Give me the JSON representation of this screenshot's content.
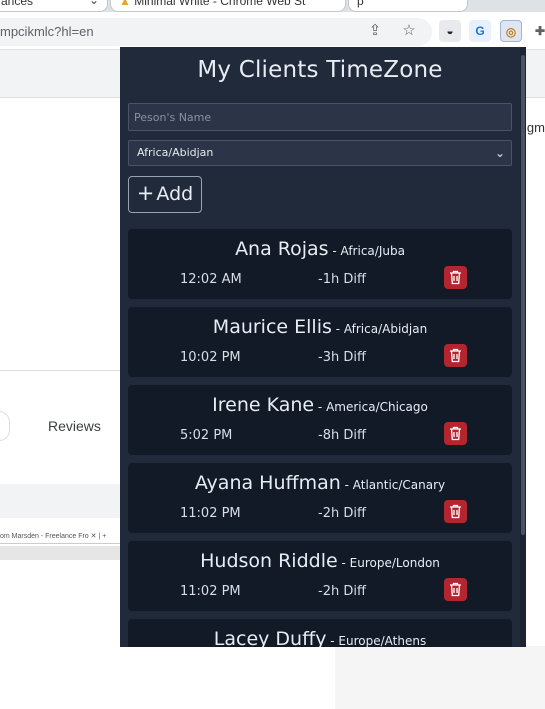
{
  "browser": {
    "tabs": [
      {
        "title": "ances"
      },
      {
        "title": "Minimal White - Chrome Web St"
      },
      {
        "title": "p"
      }
    ],
    "url": "mpcikmlc?hl=en",
    "icons": {
      "share": "share-icon",
      "bookmark": "star-icon",
      "ext1": "incognito-icon",
      "ext2": "translate-icon",
      "ext3": "timezone-extension-icon",
      "puzzle": "extensions-puzzle-icon"
    }
  },
  "page": {
    "right_text": "igma",
    "reviews_tab": "Reviews",
    "mini_tab_text": "om Marsden - Freelance Fro"
  },
  "popup": {
    "title": "My Clients TimeZone",
    "name_input": {
      "placeholder": "Peson's Name",
      "value": ""
    },
    "timezone_select": {
      "value": "Africa/Abidjan"
    },
    "add_button": {
      "label": "Add"
    },
    "clients": [
      {
        "name": "Ana Rojas",
        "timezone": "Africa/Juba",
        "time": "12:02 AM",
        "diff": "-1h Diff"
      },
      {
        "name": "Maurice Ellis",
        "timezone": "Africa/Abidjan",
        "time": "10:02 PM",
        "diff": "-3h Diff"
      },
      {
        "name": "Irene Kane",
        "timezone": "America/Chicago",
        "time": "5:02 PM",
        "diff": "-8h Diff"
      },
      {
        "name": "Ayana Huffman",
        "timezone": "Atlantic/Canary",
        "time": "11:02 PM",
        "diff": "-2h Diff"
      },
      {
        "name": "Hudson Riddle",
        "timezone": "Europe/London",
        "time": "11:02 PM",
        "diff": "-2h Diff"
      },
      {
        "name": "Lacey Duffy",
        "timezone": "Europe/Athens",
        "time": "",
        "diff": ""
      }
    ]
  },
  "colors": {
    "popup_bg": "#212a3b",
    "card_bg": "#121927",
    "delete_red": "#b32630"
  }
}
